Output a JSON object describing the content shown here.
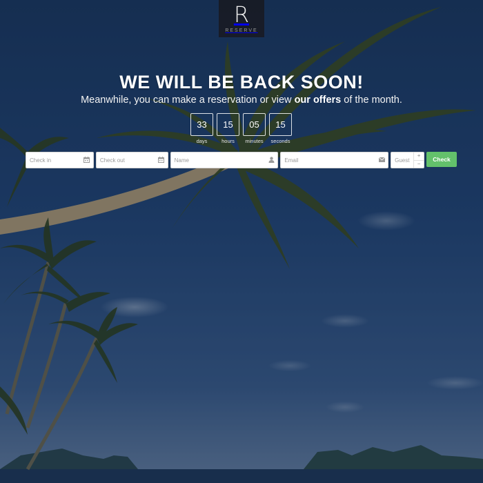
{
  "brand": {
    "logo_letter": "R",
    "logo_word": "RESERVE"
  },
  "hero": {
    "headline": "WE WILL BE BACK SOON!",
    "subline_before": "Meanwhile, you can make a reservation or view ",
    "subline_highlight": "our offers",
    "subline_after": " of the month."
  },
  "countdown": [
    {
      "value": "33",
      "label": "days"
    },
    {
      "value": "15",
      "label": "hours"
    },
    {
      "value": "05",
      "label": "minutes"
    },
    {
      "value": "15",
      "label": "seconds"
    }
  ],
  "form": {
    "checkin_placeholder": "Check in",
    "checkout_placeholder": "Check out",
    "name_placeholder": "Name",
    "email_placeholder": "Email",
    "guest_placeholder": "Guest",
    "submit_label": "Check",
    "stepper_plus": "+",
    "stepper_minus": "−",
    "accent_color": "#63c16b"
  },
  "icons": [
    "calendar-icon",
    "user-icon",
    "envelope-icon",
    "plus-icon",
    "minus-icon"
  ]
}
